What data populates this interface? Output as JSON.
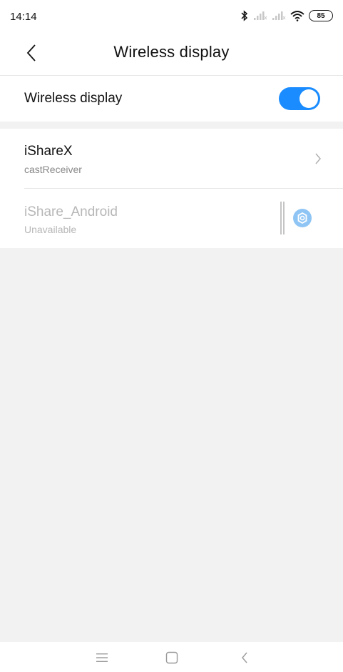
{
  "status_bar": {
    "time": "14:14",
    "battery": "85",
    "icons": [
      "bluetooth-icon",
      "signal-icon",
      "signal-icon",
      "wifi-icon",
      "battery-icon"
    ]
  },
  "header": {
    "title": "Wireless display",
    "back_icon": "chevron-left-icon"
  },
  "toggle": {
    "label": "Wireless display",
    "state": "on",
    "color": "#1a8cff"
  },
  "devices": [
    {
      "name": "iShareX",
      "subtitle": "castReceiver",
      "icon": "chevron-right-icon",
      "enabled": true
    },
    {
      "name": "iShare_Android",
      "subtitle": "Unavailable",
      "icon": "gear-icon",
      "enabled": false
    }
  ],
  "nav_bar": {
    "items": [
      "menu-icon",
      "home-icon",
      "back-icon"
    ]
  },
  "colors": {
    "accent": "#1a8cff",
    "disabled_text": "#b7b7b7",
    "secondary_text": "#888888",
    "background_gray": "#f2f2f2"
  }
}
